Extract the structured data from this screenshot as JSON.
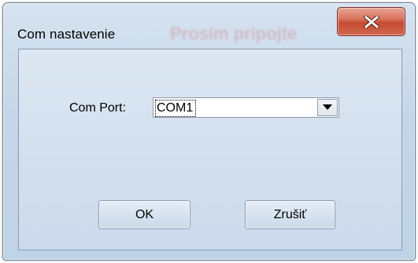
{
  "window": {
    "title": "Com nastavenie",
    "background_title_ghost": "Prosím pripojte"
  },
  "form": {
    "com_port_label": "Com Port:",
    "com_port_value": "COM1"
  },
  "buttons": {
    "ok_label": "OK",
    "cancel_label": "Zrušiť"
  },
  "icons": {
    "close": "close-icon",
    "dropdown": "chevron-down-icon"
  },
  "colors": {
    "close_button": "#c44c32",
    "dialog_background": "#c4d6e9"
  }
}
